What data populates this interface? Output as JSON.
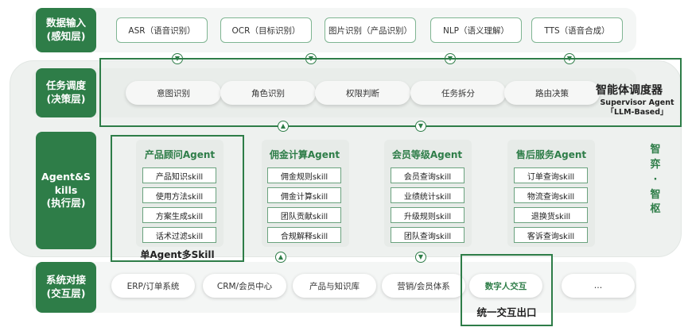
{
  "layers": {
    "input": {
      "label": "数据输入\n(感知层)",
      "items": [
        "ASR（语音识别）",
        "OCR（目标识别）",
        "图片识别（产品识别）",
        "NLP（语义理解）",
        "TTS（语音合成）"
      ]
    },
    "dispatch": {
      "label": "任务调度\n(决策层)",
      "items": [
        "意图识别",
        "角色识别",
        "权限判断",
        "任务拆分",
        "路由决策"
      ],
      "supervisor_title": "智能体调度器",
      "supervisor_sub1": "Supervisor Agent",
      "supervisor_sub2": "「LLM-Based」"
    },
    "execution": {
      "label": "Agent&S\nkills\n(执行层)",
      "agents": [
        {
          "title": "产品顾问Agent",
          "skills": [
            "产品知识skill",
            "使用方法skill",
            "方案生成skill",
            "话术过滤skill"
          ]
        },
        {
          "title": "佣金计算Agent",
          "skills": [
            "佣金规则skill",
            "佣金计算skill",
            "团队贡献skill",
            "合规解释skill"
          ]
        },
        {
          "title": "会员等级Agent",
          "skills": [
            "会员查询skill",
            "业绩统计skill",
            "升级规则skill",
            "团队查询skill"
          ]
        },
        {
          "title": "售后服务Agent",
          "skills": [
            "订单查询skill",
            "物流查询skill",
            "退换货skill",
            "客诉查询skill"
          ]
        }
      ],
      "highlight_caption": "单Agent多Skill",
      "side_label": [
        "智",
        "弈",
        "·",
        "智",
        "枢"
      ]
    },
    "system": {
      "label": "系统对接\n(交互层)",
      "items": [
        "ERP/订单系统",
        "CRM/会员中心",
        "产品与知识库",
        "营销/会员体系",
        "数字人交互",
        "…"
      ],
      "highlight_caption": "统一交互出口"
    }
  },
  "colors": {
    "accent": "#2e7d48",
    "accent_light": "#7fb592"
  },
  "icons": {
    "down_arrow": "arrow-down-circle-icon",
    "up_arrow": "arrow-up-circle-icon"
  }
}
